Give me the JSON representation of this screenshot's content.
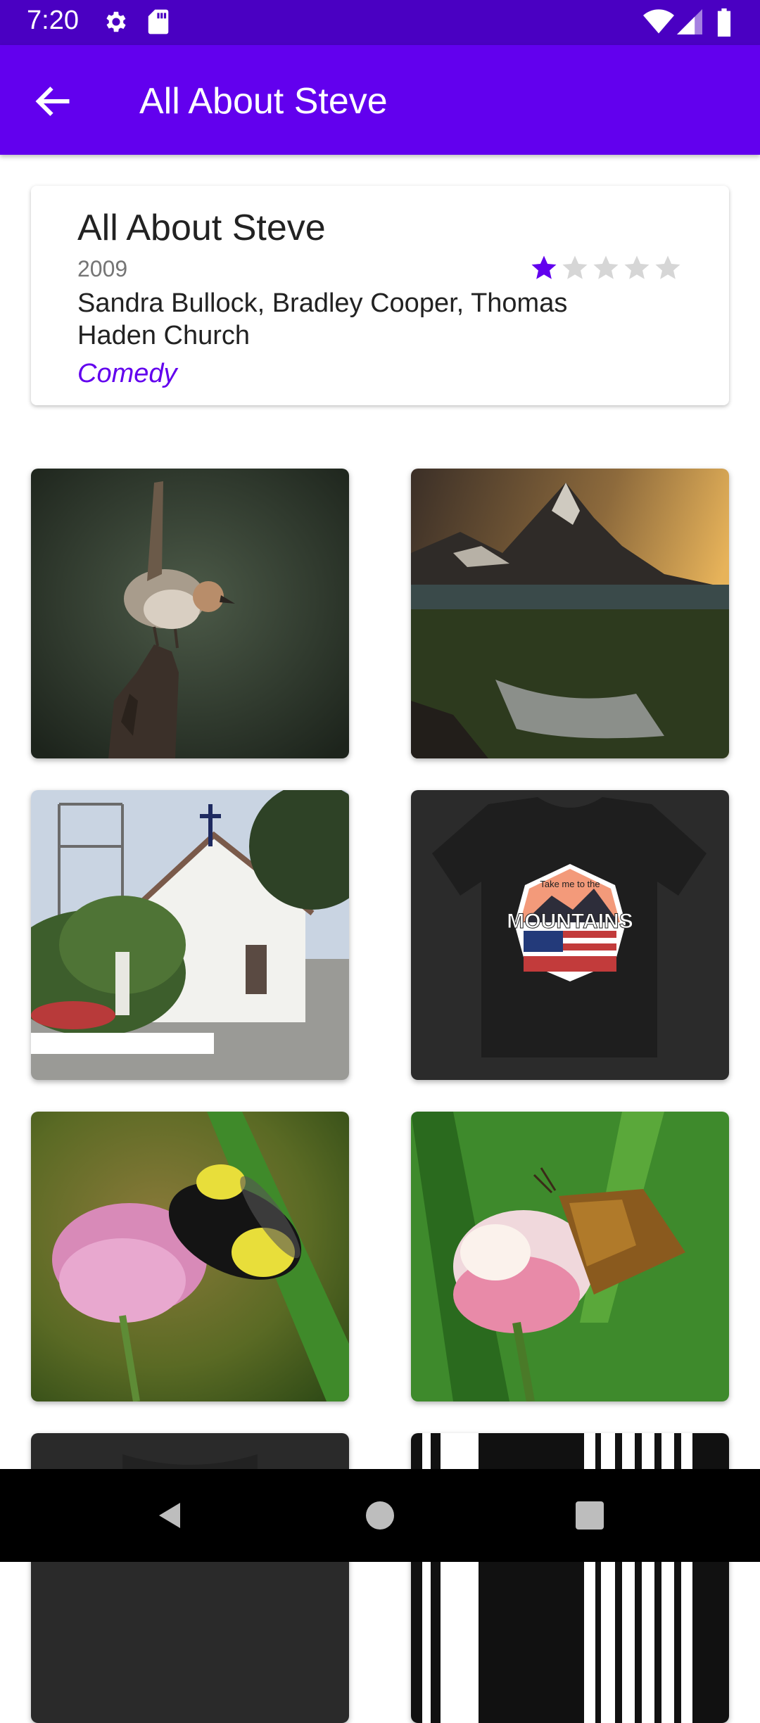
{
  "status_bar": {
    "time": "7:20",
    "icons": [
      "gear-icon",
      "sd-card-icon",
      "wifi-icon",
      "signal-icon",
      "battery-icon"
    ]
  },
  "app_bar": {
    "title": "All About Steve",
    "back_icon": "arrow-left-icon"
  },
  "movie": {
    "title": "All About Steve",
    "year": "2009",
    "cast": "Sandra Bullock, Bradley Cooper, Thomas Haden Church",
    "genre": "Comedy",
    "rating": 1,
    "rating_max": 5
  },
  "gallery": {
    "images": [
      {
        "subject": "bird on post"
      },
      {
        "subject": "mountain lake sunset"
      },
      {
        "subject": "church with bell tower"
      },
      {
        "subject": "black t-shirt",
        "shirt_text": "MOUNTAINS",
        "shirt_small_text": "Take me to the"
      },
      {
        "subject": "bumblebee on clover"
      },
      {
        "subject": "butterfly on clover"
      },
      {
        "subject": "dark shirt (partial)"
      },
      {
        "subject": "black and white stripes (partial)"
      }
    ]
  },
  "nav_bar": {
    "icons": [
      "back-triangle-icon",
      "home-circle-icon",
      "recents-square-icon"
    ]
  },
  "colors": {
    "status_bar": "#4a00c2",
    "app_bar": "#6200ee",
    "accent": "#6200ee",
    "star_empty": "#d6d6d6"
  }
}
